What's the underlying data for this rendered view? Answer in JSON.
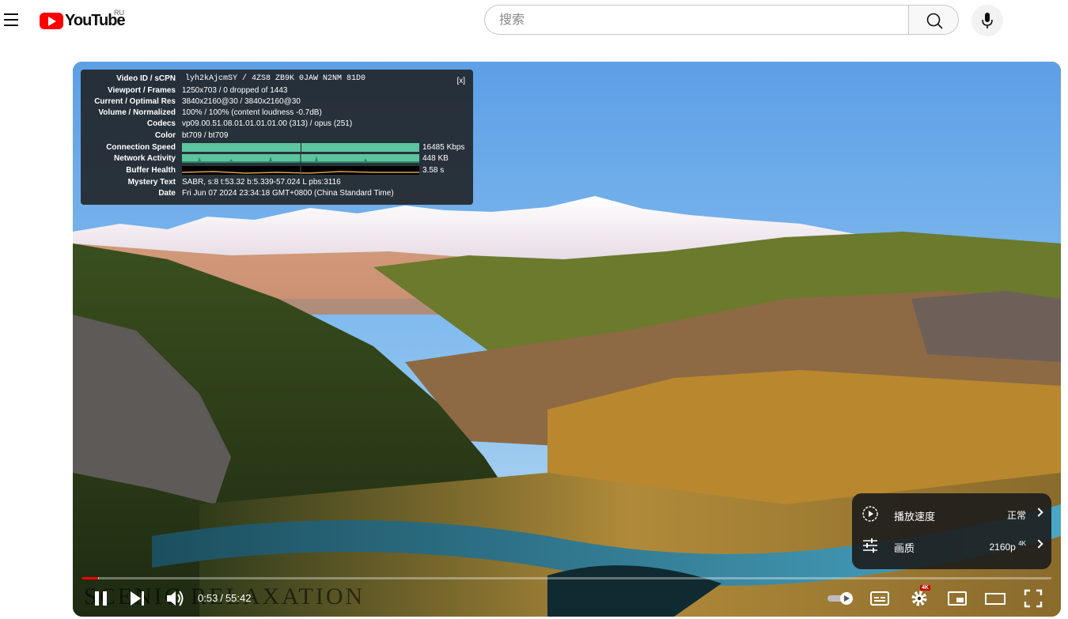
{
  "header": {
    "logo_text": "YouTube",
    "country_code": "RU",
    "search_placeholder": "搜索"
  },
  "video": {
    "title_overlay": "SCENIC RELAXATION"
  },
  "stats": {
    "close_label": "[x]",
    "rows": [
      {
        "key": "Video ID / sCPN",
        "value": "lyh2kAjcmSY / 4ZS8 ZB9K 0JAW N2NM 81D0"
      },
      {
        "key": "Viewport / Frames",
        "value": "1250x703 / 0 dropped of 1443"
      },
      {
        "key": "Current / Optimal Res",
        "value": "3840x2160@30 / 3840x2160@30"
      },
      {
        "key": "Volume / Normalized",
        "value": "100% / 100% (content loudness -0.7dB)"
      },
      {
        "key": "Codecs",
        "value": "vp09.00.51.08.01.01.01.01.00 (313) / opus (251)"
      },
      {
        "key": "Color",
        "value": "bt709 / bt709"
      },
      {
        "key": "Connection Speed",
        "value": "16485 Kbps"
      },
      {
        "key": "Network Activity",
        "value": "448 KB"
      },
      {
        "key": "Buffer Health",
        "value": "3.58 s"
      },
      {
        "key": "Mystery Text",
        "value": "SABR, s:8 t:53.32 b:5.339-57.024 L pbs:3116"
      },
      {
        "key": "Date",
        "value": "Fri Jun 07 2024 23:34:18 GMT+0800 (China Standard Time)"
      }
    ]
  },
  "settings_menu": {
    "speed_label": "播放速度",
    "speed_value": "正常",
    "quality_label": "画质",
    "quality_value": "2160p",
    "quality_badge": "4K"
  },
  "controls": {
    "current_time": "0:53",
    "separator": "/",
    "duration": "55:42",
    "progress_fraction": 0.016,
    "buffered_fraction": 0.017,
    "settings_badge": "4K",
    "colors": {
      "accent": "#ff0000",
      "stats_bar": "#5cc59e"
    }
  }
}
